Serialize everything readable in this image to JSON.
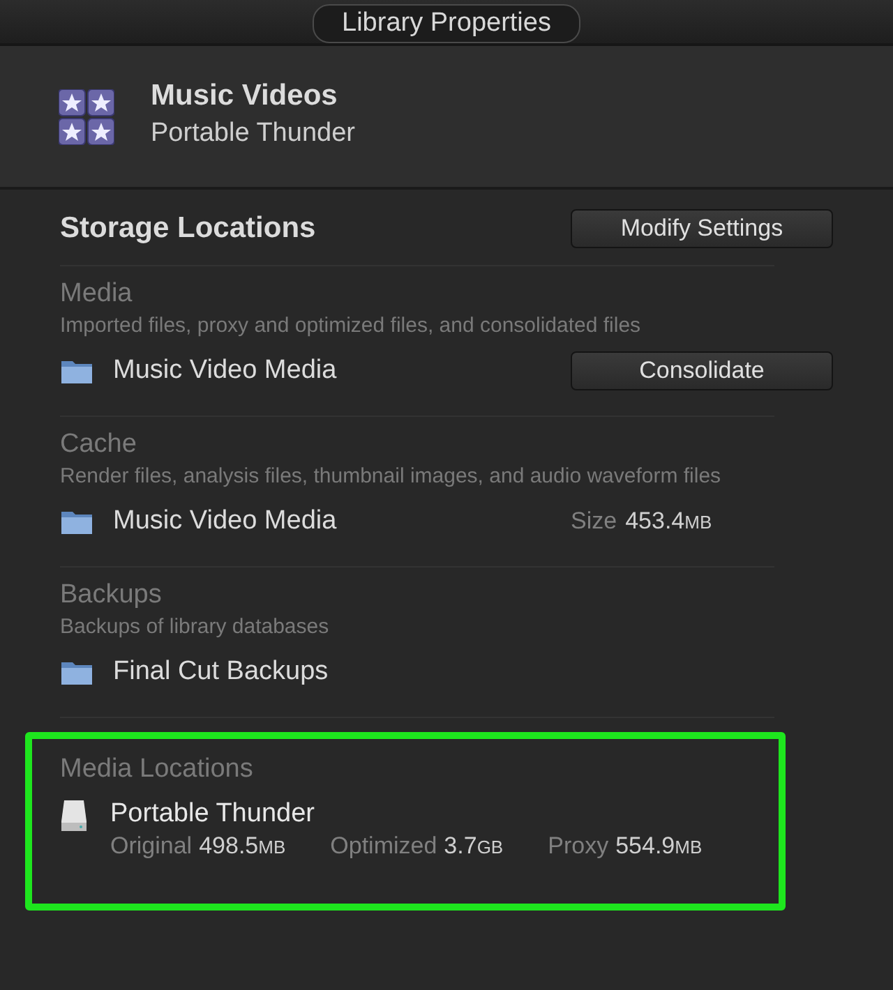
{
  "window": {
    "title": "Library Properties"
  },
  "library": {
    "name": "Music Videos",
    "location": "Portable Thunder"
  },
  "storage": {
    "title": "Storage Locations",
    "button": "Modify Settings",
    "sections": [
      {
        "kind": "button",
        "title": "Media",
        "description": "Imported files, proxy and optimized files, and consolidated files",
        "folder": "Music Video Media",
        "action": "Consolidate"
      },
      {
        "kind": "size",
        "title": "Cache",
        "description": "Render files, analysis files, thumbnail images, and audio waveform files",
        "folder": "Music Video Media",
        "size_label": "Size",
        "size_value": "453.4",
        "size_unit": "MB"
      },
      {
        "kind": "plain",
        "title": "Backups",
        "description": "Backups of library databases",
        "folder": "Final Cut Backups"
      }
    ]
  },
  "media_locations": {
    "title": "Media Locations",
    "highlighted": true,
    "drives": [
      {
        "name": "Portable Thunder",
        "stats": [
          {
            "label": "Original",
            "value": "498.5",
            "unit": "MB"
          },
          {
            "label": "Optimized",
            "value": "3.7",
            "unit": "GB"
          },
          {
            "label": "Proxy",
            "value": "554.9",
            "unit": "MB"
          }
        ]
      }
    ]
  }
}
